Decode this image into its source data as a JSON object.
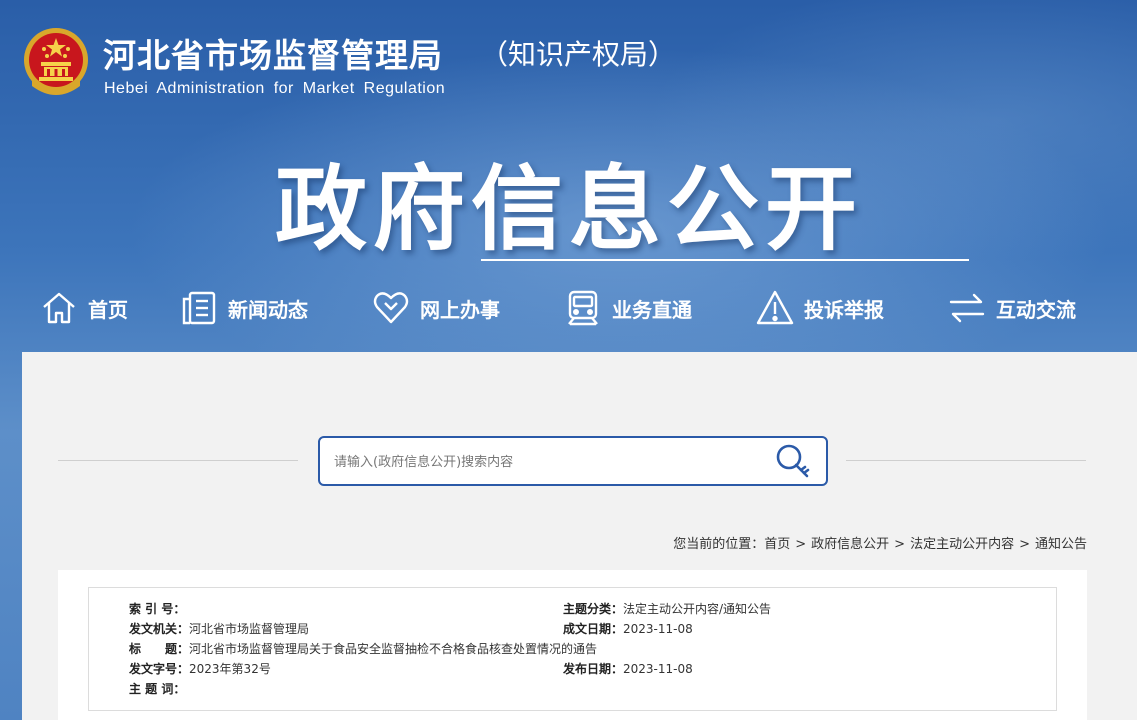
{
  "header": {
    "title": "河北省市场监督管理局",
    "subtitle": "（知识产权局）",
    "english": "Hebei Administration for Market Regulation",
    "banner_title": "政府信息公开"
  },
  "nav": [
    {
      "label": "首页",
      "icon": "home-icon"
    },
    {
      "label": "新闻动态",
      "icon": "news-icon"
    },
    {
      "label": "网上办事",
      "icon": "heart-icon"
    },
    {
      "label": "业务直通",
      "icon": "train-icon"
    },
    {
      "label": "投诉举报",
      "icon": "warning-icon"
    },
    {
      "label": "互动交流",
      "icon": "exchange-icon"
    }
  ],
  "search": {
    "placeholder": "请输入(政府信息公开)搜索内容"
  },
  "breadcrumb": {
    "prefix": "您当前的位置：",
    "items": [
      "首页",
      "政府信息公开",
      "法定主动公开内容",
      "通知公告"
    ],
    "separator": ">"
  },
  "meta": {
    "index_label": "索 引 号：",
    "index_value": "",
    "category_label": "主题分类：",
    "category_value": "法定主动公开内容/通知公告",
    "issuer_label": "发文机关：",
    "issuer_value": "河北省市场监督管理局",
    "created_label": "成文日期：",
    "created_value": "2023-11-08",
    "title_label": "标　　题：",
    "title_value": "河北省市场监督管理局关于食品安全监督抽检不合格食品核查处置情况的通告",
    "docno_label": "发文字号：",
    "docno_value": "2023年第32号",
    "published_label": "发布日期：",
    "published_value": "2023-11-08",
    "keywords_label": "主 题 词：",
    "keywords_value": ""
  },
  "colors": {
    "banner_blue": "#3a6fb3",
    "search_border": "#2b5aa8",
    "content_bg": "#f2f2f2"
  }
}
